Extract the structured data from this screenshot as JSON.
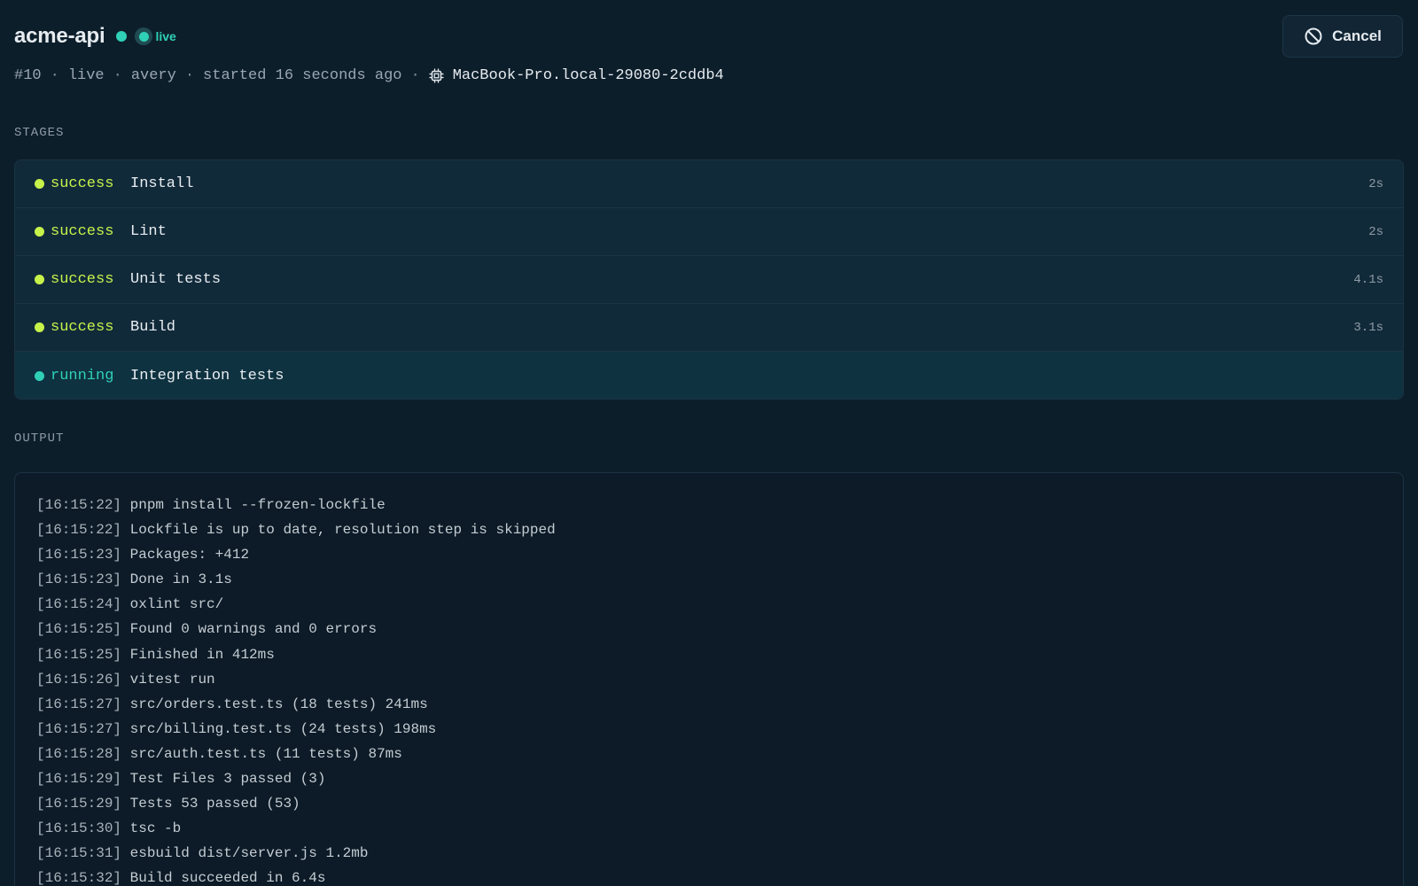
{
  "header": {
    "title": "acme-api",
    "live_label": "live",
    "cancel_label": "Cancel"
  },
  "meta": {
    "run_number": "#10",
    "status": "live",
    "user": "avery",
    "started": "started 16 seconds ago",
    "host": "MacBook-Pro.local-29080-2cddb4",
    "separator": "·"
  },
  "sections": {
    "stages": "STAGES",
    "output": "OUTPUT"
  },
  "colors": {
    "success": "#c6f24a",
    "running": "#2fd0b5",
    "live": "#2fd0b5"
  },
  "stages": [
    {
      "status": "success",
      "name": "Install",
      "duration": "2s"
    },
    {
      "status": "success",
      "name": "Lint",
      "duration": "2s"
    },
    {
      "status": "success",
      "name": "Unit tests",
      "duration": "4.1s"
    },
    {
      "status": "success",
      "name": "Build",
      "duration": "3.1s"
    },
    {
      "status": "running",
      "name": "Integration tests",
      "duration": ""
    }
  ],
  "output": [
    {
      "ts": "[16:15:22]",
      "text": "pnpm install --frozen-lockfile"
    },
    {
      "ts": "[16:15:22]",
      "text": "Lockfile is up to date, resolution step is skipped"
    },
    {
      "ts": "[16:15:23]",
      "text": "Packages: +412"
    },
    {
      "ts": "[16:15:23]",
      "text": "Done in 3.1s"
    },
    {
      "ts": "[16:15:24]",
      "text": "oxlint src/"
    },
    {
      "ts": "[16:15:25]",
      "text": "Found 0 warnings and 0 errors"
    },
    {
      "ts": "[16:15:25]",
      "text": "Finished in 412ms"
    },
    {
      "ts": "[16:15:26]",
      "text": "vitest run"
    },
    {
      "ts": "[16:15:27]",
      "text": "src/orders.test.ts (18 tests) 241ms"
    },
    {
      "ts": "[16:15:27]",
      "text": "src/billing.test.ts (24 tests) 198ms"
    },
    {
      "ts": "[16:15:28]",
      "text": "src/auth.test.ts (11 tests) 87ms"
    },
    {
      "ts": "[16:15:29]",
      "text": "Test Files 3 passed (3)"
    },
    {
      "ts": "[16:15:29]",
      "text": "Tests 53 passed (53)"
    },
    {
      "ts": "[16:15:30]",
      "text": "tsc -b"
    },
    {
      "ts": "[16:15:31]",
      "text": "esbuild dist/server.js 1.2mb"
    },
    {
      "ts": "[16:15:32]",
      "text": "Build succeeded in 6.4s"
    }
  ]
}
